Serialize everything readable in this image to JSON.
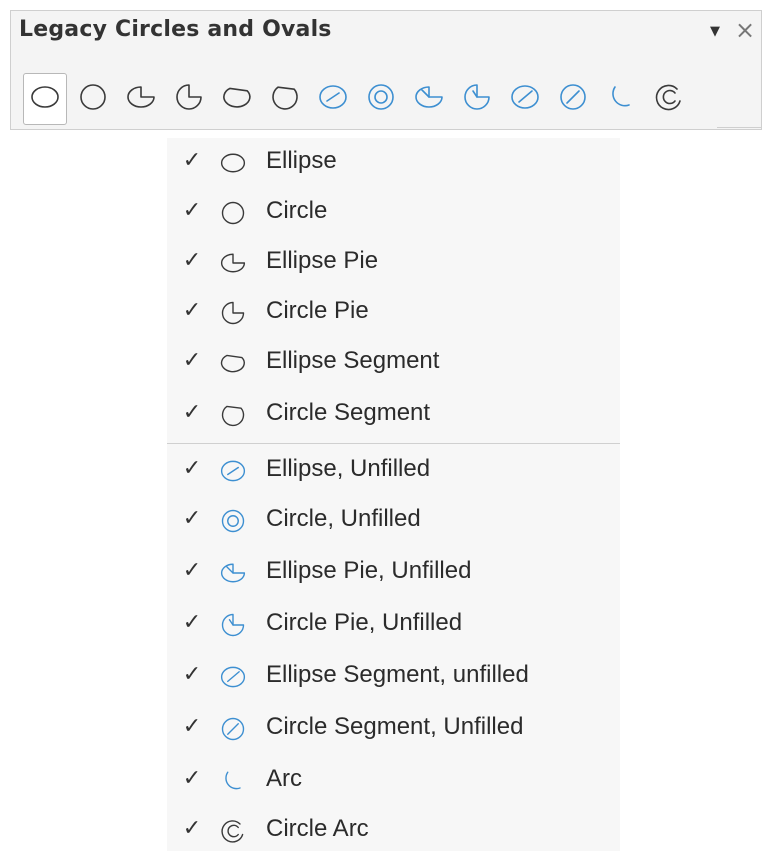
{
  "toolbar": {
    "title": "Legacy Circles and Ovals",
    "dropdown_glyph": "▼",
    "close_glyph": "×",
    "buttons": [
      {
        "icon": "ellipse-icon",
        "style": "filled",
        "selected": true
      },
      {
        "icon": "circle-icon",
        "style": "filled"
      },
      {
        "icon": "ellipse-pie-icon",
        "style": "filled"
      },
      {
        "icon": "circle-pie-icon",
        "style": "filled"
      },
      {
        "icon": "ellipse-segment-icon",
        "style": "filled"
      },
      {
        "icon": "circle-segment-icon",
        "style": "filled"
      },
      {
        "icon": "ellipse-unfilled-icon",
        "style": "unfilled"
      },
      {
        "icon": "circle-unfilled-icon",
        "style": "unfilled"
      },
      {
        "icon": "ellipse-pie-unfilled-icon",
        "style": "unfilled"
      },
      {
        "icon": "circle-pie-unfilled-icon",
        "style": "unfilled"
      },
      {
        "icon": "ellipse-segment-unfilled-icon",
        "style": "unfilled"
      },
      {
        "icon": "circle-segment-unfilled-icon",
        "style": "unfilled"
      },
      {
        "icon": "arc-icon",
        "style": "unfilled"
      },
      {
        "icon": "circle-arc-icon",
        "style": "filled"
      }
    ]
  },
  "menu": {
    "check_glyph": "✓",
    "items": [
      {
        "label": "Ellipse",
        "icon": "ellipse-icon",
        "checked": true
      },
      {
        "label": "Circle",
        "icon": "circle-icon",
        "checked": true
      },
      {
        "label": "Ellipse Pie",
        "icon": "ellipse-pie-icon",
        "checked": true
      },
      {
        "label": "Circle Pie",
        "icon": "circle-pie-icon",
        "checked": true
      },
      {
        "label": "Ellipse Segment",
        "icon": "ellipse-segment-icon",
        "checked": true
      },
      {
        "label": "Circle Segment",
        "icon": "circle-segment-icon",
        "checked": true
      },
      {
        "label": "Ellipse, Unfilled",
        "icon": "ellipse-unfilled-icon",
        "checked": true
      },
      {
        "label": "Circle, Unfilled",
        "icon": "circle-unfilled-icon",
        "checked": true
      },
      {
        "label": "Ellipse Pie, Unfilled",
        "icon": "ellipse-pie-unfilled-icon",
        "checked": true
      },
      {
        "label": "Circle Pie, Unfilled",
        "icon": "circle-pie-unfilled-icon",
        "checked": true
      },
      {
        "label": "Ellipse Segment, unfilled",
        "icon": "ellipse-segment-unfilled-icon",
        "checked": true
      },
      {
        "label": "Circle Segment, Unfilled",
        "icon": "circle-segment-unfilled-icon",
        "checked": true
      },
      {
        "label": "Arc",
        "icon": "arc-icon",
        "checked": true
      },
      {
        "label": "Circle Arc",
        "icon": "circle-arc-icon",
        "checked": true
      }
    ]
  },
  "colors": {
    "filled_icon": "#3a3a3a",
    "unfilled_icon": "#3d8fd1",
    "menu_bg": "#f7f7f7",
    "toolbar_bg": "#f4f4f4"
  }
}
